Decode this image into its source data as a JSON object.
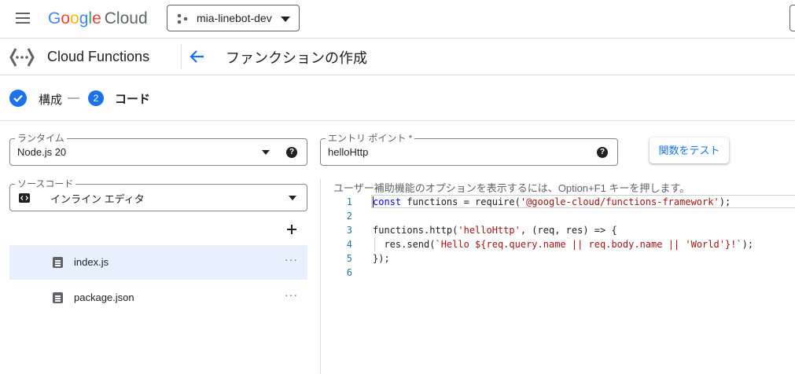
{
  "header": {
    "logo_google": "Google",
    "logo_cloud": "Cloud",
    "project": "mia-linebot-dev"
  },
  "subheader": {
    "product": "Cloud Functions",
    "title": "ファンクションの作成"
  },
  "stepper": {
    "step1_label": "構成",
    "separator": "—",
    "step2_number": "2",
    "step2_label": "コード"
  },
  "runtime": {
    "label": "ランタイム",
    "value": "Node.js 20"
  },
  "entry_point": {
    "label": "エントリ ポイント *",
    "value": "helloHttp"
  },
  "test_button": "関数をテスト",
  "source": {
    "label": "ソースコード",
    "value": "インライン エディタ"
  },
  "files": [
    {
      "name": "index.js",
      "selected": true
    },
    {
      "name": "package.json",
      "selected": false
    }
  ],
  "editor": {
    "hint": "ユーザー補助機能のオプションを表示するには、Option+F1 キーを押します。",
    "line_numbers": [
      "1",
      "2",
      "3",
      "4",
      "5",
      "6"
    ],
    "lines": [
      "const functions = require('@google-cloud/functions-framework');",
      "",
      "functions.http('helloHttp', (req, res) => {",
      "  res.send(`Hello ${req.query.name || req.body.name || 'World'}!`);",
      "});",
      ""
    ]
  },
  "colors": {
    "accent": "#1a73e8",
    "selected_row": "#e8f0fe",
    "keyword": "#0000ff",
    "string": "#a31515",
    "line_number": "#237893"
  },
  "icons": [
    "menu-icon",
    "project-icon",
    "dropdown-icon",
    "cloud-functions-icon",
    "back-arrow-icon",
    "check-icon",
    "help-icon",
    "code-icon",
    "add-icon",
    "file-icon",
    "more-icon"
  ]
}
